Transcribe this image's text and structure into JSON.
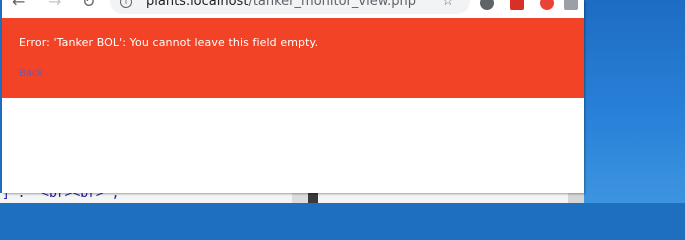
{
  "browser": {
    "url_host": "plants.localhost",
    "url_path": "/tanker_monitor_view.php"
  },
  "error": {
    "message": "Error: 'Tanker BOL': You cannot leave this field empty.",
    "back_label": "Back"
  },
  "background_editor": {
    "code_line": "] . '<br><br>';"
  },
  "colors": {
    "error_banner": "#f24327",
    "error_text": "#ffffff",
    "back_link": "#6d5aa8",
    "desktop": "#1e6fbf"
  }
}
